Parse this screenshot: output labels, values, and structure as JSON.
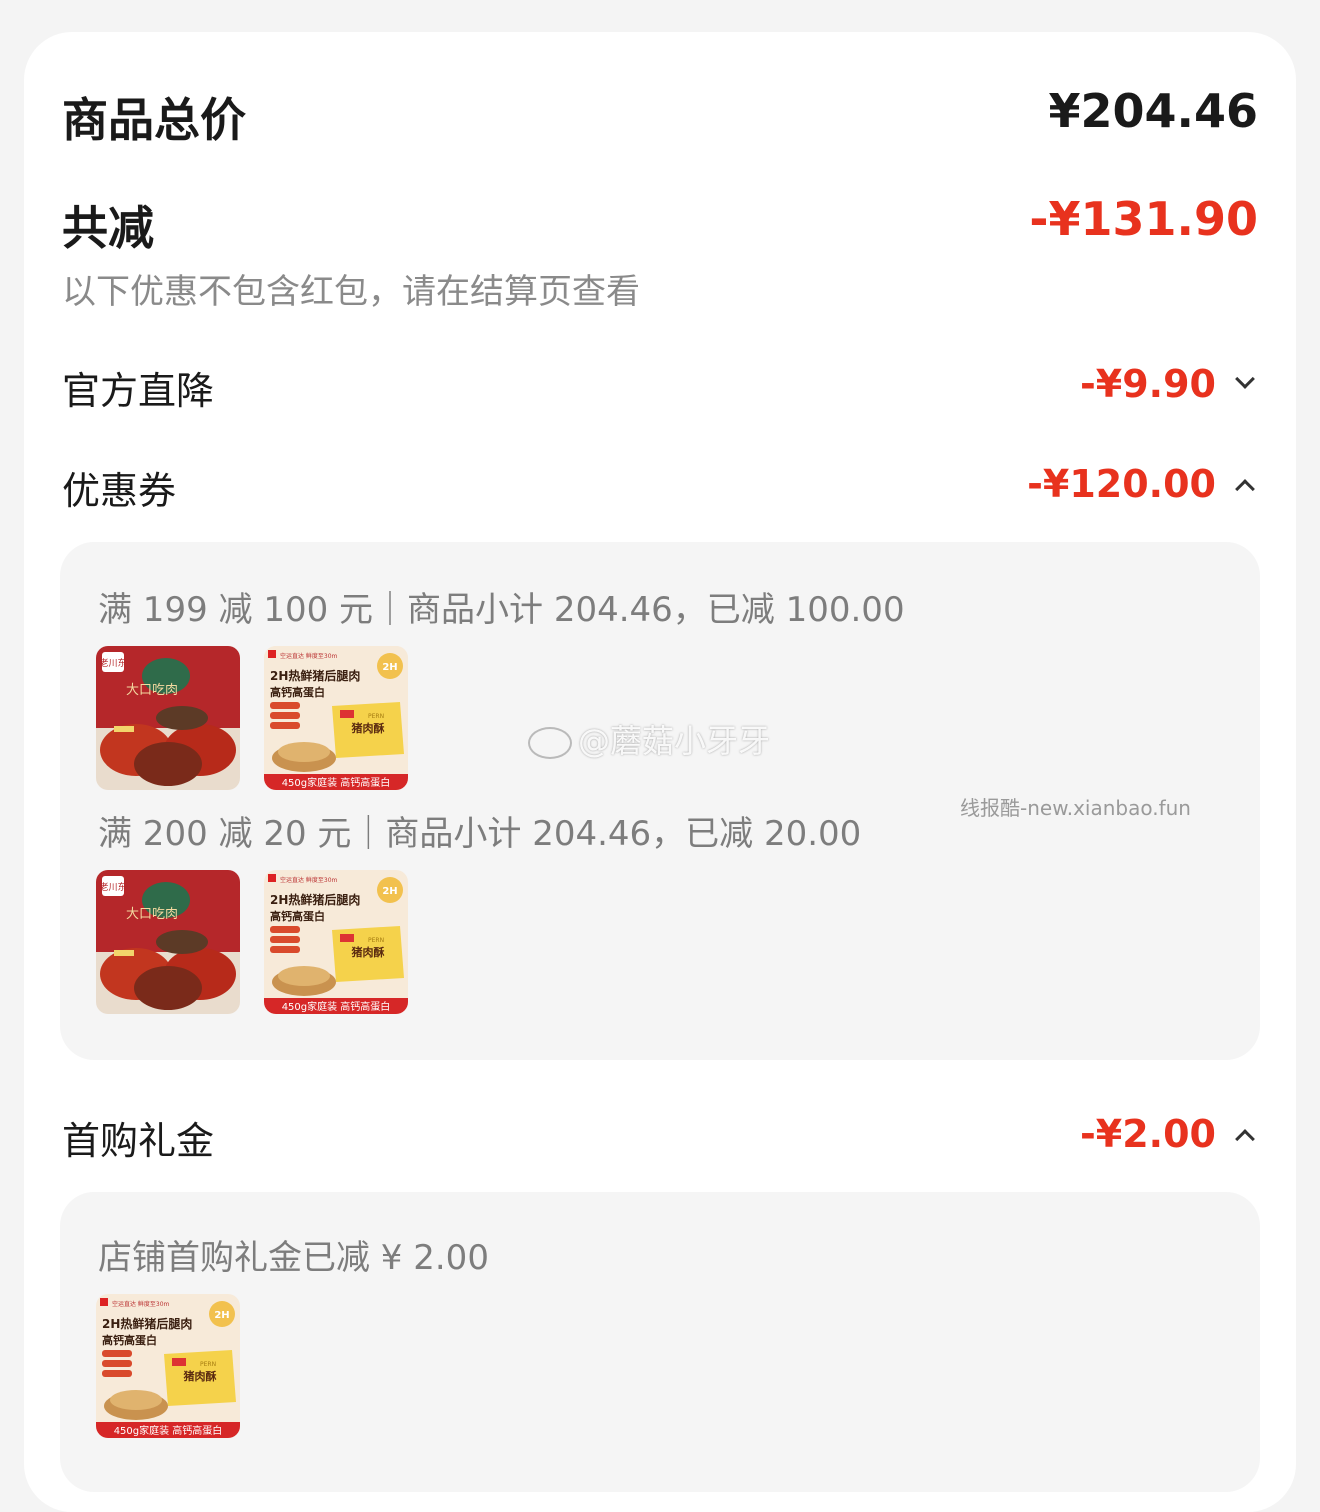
{
  "summary": {
    "total_label": "商品总价",
    "total_value": "¥204.46",
    "discount_label": "共减",
    "discount_value": "-¥131.90",
    "note": "以下优惠不包含红包，请在结算页查看"
  },
  "official": {
    "label": "官方直降",
    "value": "-¥9.90",
    "expanded": false
  },
  "coupons": {
    "label": "优惠券",
    "value": "-¥120.00",
    "expanded": true,
    "rules": [
      {
        "text": "满 199 减 100 元｜商品小计 204.46，已减 100.00"
      },
      {
        "text": "满 200 减 20 元｜商品小计 204.46，已减 20.00"
      }
    ]
  },
  "first_purchase": {
    "label": "首购礼金",
    "value": "-¥2.00",
    "expanded": true,
    "rule": "店铺首购礼金已减 ¥ 2.00"
  },
  "product_pork": {
    "headline": "2H热鲜猪后腿肉",
    "subline": "高钙高蛋白",
    "tags": [
      "0添加色素",
      "0香精",
      "0防腐剂"
    ],
    "box_label": "猪肉酥",
    "box_brand": "PERN",
    "footer": "450g家庭装 高钙高蛋白",
    "badge": "2H",
    "corner_small": "空运直达 鲜度至30m"
  },
  "product_beef": {
    "brand": "老川东",
    "box_text": "大口吃肉"
  },
  "watermarks": {
    "weibo": "@蘑菇小牙牙",
    "site": "线报酷-new.xianbao.fun"
  },
  "colors": {
    "accent": "#e8321e",
    "text": "#1a1a1a",
    "muted": "#7d7d7d",
    "panel": "#f5f5f5"
  }
}
